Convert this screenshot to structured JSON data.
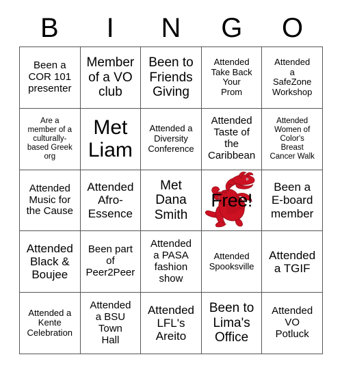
{
  "card": {
    "header_letters": [
      "B",
      "I",
      "N",
      "G",
      "O"
    ],
    "free_label": "Free!",
    "free_icon_name": "red-dragon-mascot",
    "colors": {
      "dragon_red": "#CC1122",
      "dragon_dark": "#8E0C18",
      "grid_line": "#555555",
      "text": "#000000",
      "background": "#FFFFFF"
    },
    "rows": [
      [
        {
          "text": "Been a\nCOR 101\npresenter",
          "size": "fs-m"
        },
        {
          "text": "Member\nof a VO\nclub",
          "size": "fs-xl"
        },
        {
          "text": "Been to\nFriends\nGiving",
          "size": "fs-xl"
        },
        {
          "text": "Attended\nTake Back\nYour\nProm",
          "size": "fs-s"
        },
        {
          "text": "Attended\na\nSafeZone\nWorkshop",
          "size": "fs-s"
        }
      ],
      [
        {
          "text": "Are a\nmember of a\nculturally-\nbased Greek\norg",
          "size": "fs-xs"
        },
        {
          "text": "Met\nLiam",
          "size": "fs-xxl"
        },
        {
          "text": "Attended a\nDiversity\nConference",
          "size": "fs-s"
        },
        {
          "text": "Attended\nTaste of\nthe\nCaribbean",
          "size": "fs-m"
        },
        {
          "text": "Attended\nWomen of\nColor's\nBreast\nCancer Walk",
          "size": "fs-xs"
        }
      ],
      [
        {
          "text": "Attended\nMusic for\nthe Cause",
          "size": "fs-m"
        },
        {
          "text": "Attended\nAfro-\nEssence",
          "size": "fs-l"
        },
        {
          "text": "Met\nDana\nSmith",
          "size": "fs-xl"
        },
        {
          "text": "Free!",
          "size": "free"
        },
        {
          "text": "Been a\nE-board\nmember",
          "size": "fs-l"
        }
      ],
      [
        {
          "text": "Attended\nBlack &\nBoujee",
          "size": "fs-l"
        },
        {
          "text": "Been part\nof\nPeer2Peer",
          "size": "fs-m"
        },
        {
          "text": "Attended\na PASA\nfashion\nshow",
          "size": "fs-m"
        },
        {
          "text": "Attended\nSpooksville",
          "size": "fs-s"
        },
        {
          "text": "Attended\na TGIF",
          "size": "fs-l"
        }
      ],
      [
        {
          "text": "Attended a\nKente\nCelebration",
          "size": "fs-s"
        },
        {
          "text": "Attended\na BSU\nTown\nHall",
          "size": "fs-m"
        },
        {
          "text": "Attended\nLFL's\nAreito",
          "size": "fs-l"
        },
        {
          "text": "Been to\nLima's\nOffice",
          "size": "fs-xl"
        },
        {
          "text": "Attended\nVO\nPotluck",
          "size": "fs-m"
        }
      ]
    ]
  }
}
